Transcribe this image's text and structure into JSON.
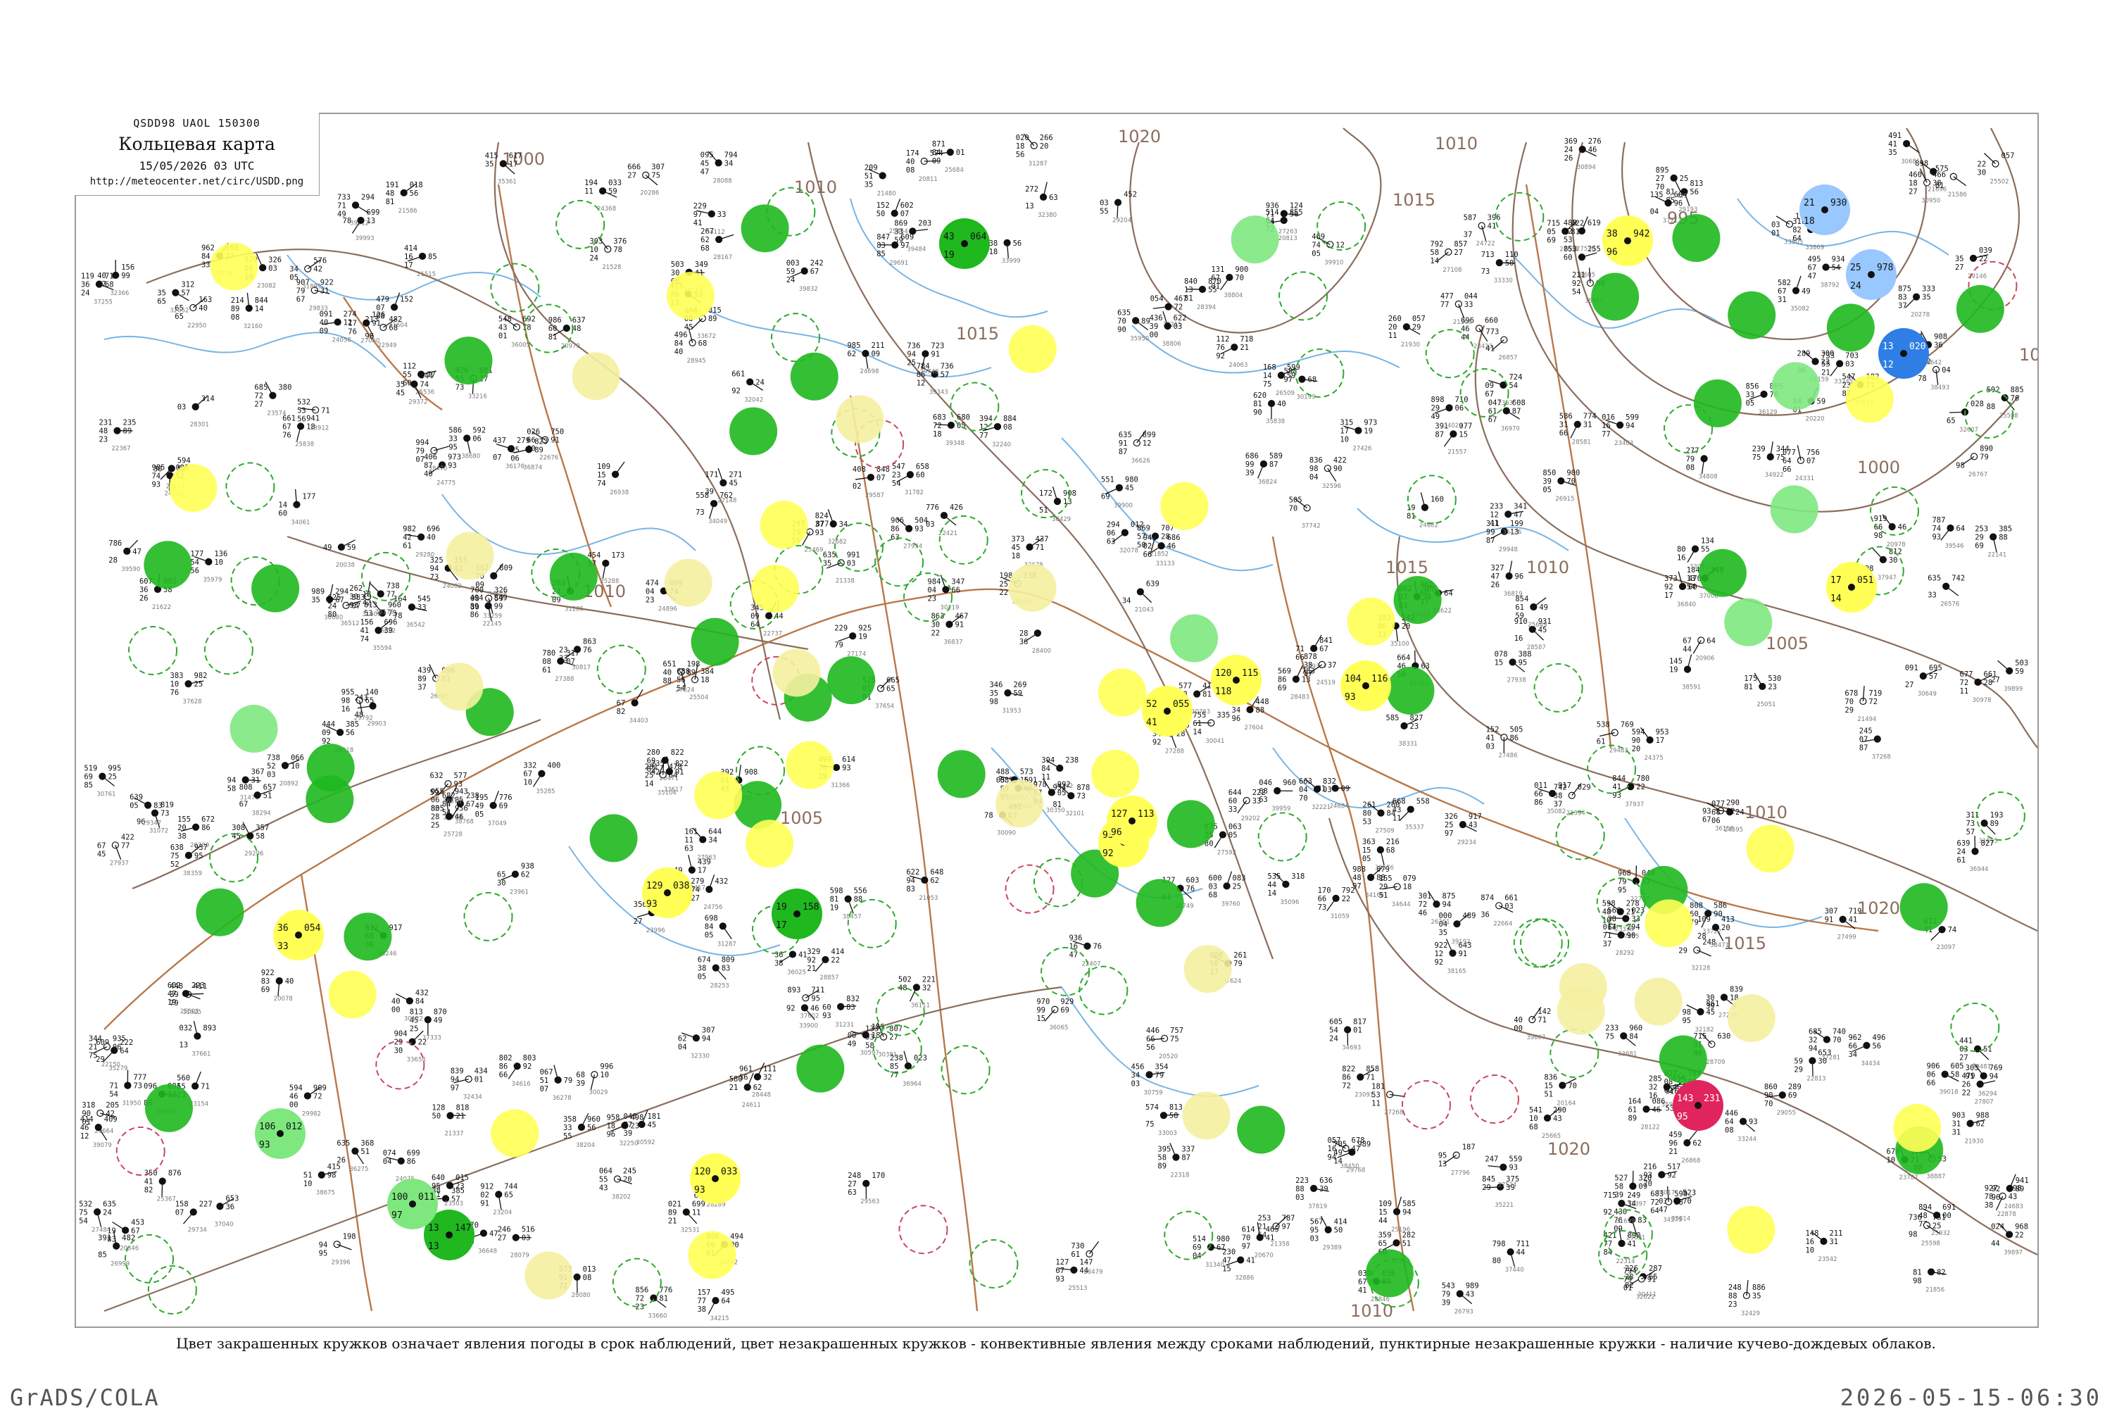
{
  "header": {
    "code": "QSDD98  UAOL  150300",
    "title": "Кольцевая карта",
    "date": "15/05/2026 03 UTC",
    "url": "http://meteocenter.net/circ/USDD.png"
  },
  "caption": "Цвет закрашенных кружков означает явления погоды в срок наблюдений, цвет незакрашенных кружков - конвективные явления между сроками наблюдений, пунктирные незакрашенные кружки - наличие кучево-дождевых облаков.",
  "footer": {
    "left": "GrADS/COLA",
    "right": "2026-05-15-06:30"
  },
  "isobar_labels": [
    "1000",
    "1005",
    "1010",
    "1015",
    "1020",
    "995"
  ],
  "colors": {
    "isobar": "#8b6d5c",
    "river": "#77b5e6",
    "border": "#b8784a",
    "rain": "#1fb81f",
    "light_rain": "#7ee87e",
    "fog": "#ffff55",
    "haze": "#f5f0a0",
    "snow_shower": "#99c7ff",
    "snow": "#2e7ee5",
    "thunder": "#e0245e",
    "cb_outline": "#2ea82e",
    "ts_outline": "#c8485e"
  },
  "stations": [
    {
      "t": "43",
      "td": "19",
      "p": "064",
      "w": "green"
    },
    {
      "t": "36",
      "td": "33",
      "p": "054",
      "w": "yellow"
    },
    {
      "t": "13",
      "td": "13",
      "p": "147",
      "w": "green"
    },
    {
      "t": "19",
      "td": "17",
      "p": "158",
      "w": "green"
    },
    {
      "t": "52",
      "td": "41",
      "p": "055",
      "w": "yellow"
    },
    {
      "t": "120",
      "td": "118",
      "p": "115",
      "w": "yellow"
    },
    {
      "t": "104",
      "td": "93",
      "p": "116",
      "w": "yellow"
    },
    {
      "t": "93",
      "td": "92",
      "p": "108",
      "w": "yellow"
    },
    {
      "t": "127",
      "td": "96",
      "p": "113",
      "w": "yellow"
    },
    {
      "t": "143",
      "td": "95",
      "p": "231",
      "w": "red"
    },
    {
      "t": "21",
      "td": "18",
      "p": "930",
      "w": "lightblue"
    },
    {
      "t": "25",
      "td": "24",
      "p": "978",
      "w": "lightblue"
    },
    {
      "t": "13",
      "td": "12",
      "p": "020",
      "w": "blue"
    },
    {
      "t": "38",
      "td": "96",
      "p": "942",
      "w": "yellow"
    },
    {
      "t": "17",
      "td": "14",
      "p": "051",
      "w": "yellow"
    },
    {
      "t": "106",
      "td": "93",
      "p": "012",
      "w": "lightgreen"
    },
    {
      "t": "100",
      "td": "97",
      "p": "011",
      "w": "lightgreen"
    },
    {
      "t": "129",
      "td": "93",
      "p": "038",
      "w": "yellow"
    },
    {
      "t": "120",
      "td": "93",
      "p": "033",
      "w": "yellow"
    }
  ]
}
